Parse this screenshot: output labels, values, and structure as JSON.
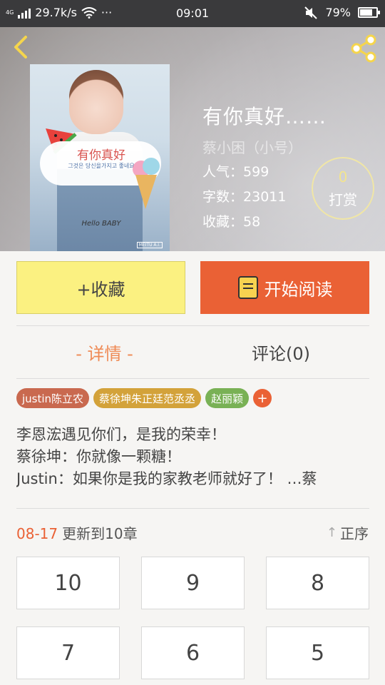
{
  "status_bar": {
    "network_type": "4G",
    "speed": "29.7k/s",
    "dots": "···",
    "time": "09:01",
    "battery": "79%",
    "battery_level": 0.79
  },
  "header": {
    "back_icon": "chevron-left-icon",
    "share_icon": "share-icon",
    "cover": {
      "title": "有你真好",
      "subtitle": "그것은 당신을가지고 좋네요",
      "hello": "Hello BABY",
      "mark": "MEITU A.I."
    },
    "book_title": "有你真好……",
    "author": "蔡小困（小号）",
    "popularity_label": "人气：",
    "popularity": "599",
    "word_count_label": "字数：",
    "word_count": "23011",
    "favorites_label": "收藏：",
    "favorites": "58",
    "reward_count": "0",
    "reward_label": "打赏",
    "accent_color": "#f3e58f"
  },
  "actions": {
    "favorite_label": "+收藏",
    "read_label": "开始阅读",
    "read_icon": "book-icon",
    "favorite_color": "#fbf181",
    "read_color": "#ea6135"
  },
  "tabs": {
    "detail": "- 详情 -",
    "comment": "评论(0)"
  },
  "tags": [
    {
      "label": "justin陈立农",
      "color": "#c9694f"
    },
    {
      "label": "蔡徐坤朱正廷范丞丞",
      "color": "#d3a23a"
    },
    {
      "label": "赵丽颖",
      "color": "#79b155"
    }
  ],
  "tag_add": "+",
  "description": [
    "李恩浤遇见你们，是我的荣幸！",
    "蔡徐坤：你就像一颗糖！",
    "Justin：如果你是我的家教老师就好了！ …蔡"
  ],
  "update": {
    "date": "08-17",
    "text": "更新到10章"
  },
  "sort_label": "正序",
  "chapters": [
    "10",
    "9",
    "8",
    "7",
    "6",
    "5"
  ]
}
